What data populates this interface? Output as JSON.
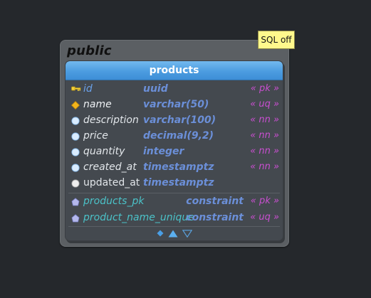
{
  "sql_toggle": {
    "label": "SQL off"
  },
  "schema": {
    "name": "public"
  },
  "table": {
    "name": "products",
    "columns": [
      {
        "name": "id",
        "type": "uuid",
        "constraint": "« pk »",
        "icon": "primary-key-icon"
      },
      {
        "name": "name",
        "type": "varchar(50)",
        "constraint": "« uq »",
        "icon": "unique-diamond-icon"
      },
      {
        "name": "description",
        "type": "varchar(100)",
        "constraint": "« nn »",
        "icon": "not-null-circle-icon"
      },
      {
        "name": "price",
        "type": "decimal(9,2)",
        "constraint": "« nn »",
        "icon": "not-null-circle-icon"
      },
      {
        "name": "quantity",
        "type": "integer",
        "constraint": "« nn »",
        "icon": "not-null-circle-icon"
      },
      {
        "name": "created_at",
        "type": "timestamptz",
        "constraint": "« nn »",
        "icon": "not-null-circle-icon"
      },
      {
        "name": "updated_at",
        "type": "timestamptz",
        "constraint": "",
        "icon": "nullable-circle-icon"
      }
    ],
    "constraints": [
      {
        "name": "products_pk",
        "type": "constraint",
        "kind": "« pk »",
        "icon": "constraint-icon"
      },
      {
        "name": "product_name_unique",
        "type": "constraint",
        "kind": "« uq »",
        "icon": "constraint-icon"
      }
    ]
  },
  "colors": {
    "background": "#25282c",
    "schema_box": "#5b5f63",
    "table_body": "#44494f",
    "header_blue": "#4c9ce0",
    "type_blue": "#6b8fd8",
    "constraint_magenta": "#c94fd0",
    "constraint_name_teal": "#4bc2c8",
    "badge_yellow": "#fff88c"
  }
}
